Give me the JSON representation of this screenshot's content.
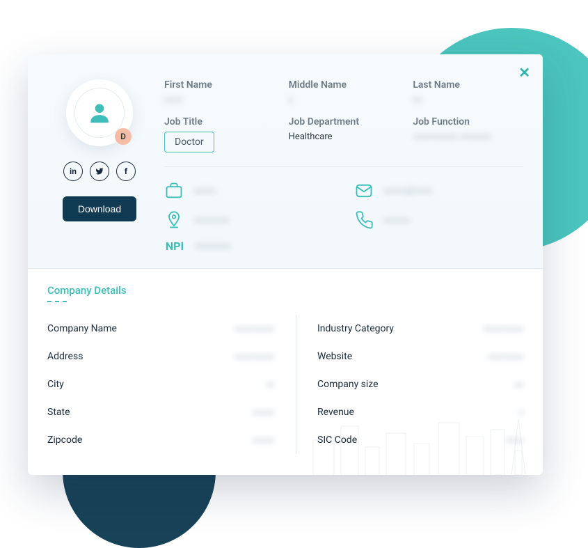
{
  "avatar_badge": "D",
  "download_label": "Download",
  "names": {
    "first": {
      "label": "First Name",
      "value": ""
    },
    "middle": {
      "label": "Middle Name",
      "value": ""
    },
    "last": {
      "label": "Last Name",
      "value": ""
    }
  },
  "job": {
    "title": {
      "label": "Job Title",
      "value": "Doctor"
    },
    "department": {
      "label": "Job Department",
      "value": "Healthcare"
    },
    "function": {
      "label": "Job Function",
      "value": ""
    }
  },
  "contacts": {
    "work": "",
    "email": "",
    "location": "",
    "phone": "",
    "npi_label": "NPI",
    "npi_value": ""
  },
  "company_section_title": "Company Details",
  "company_left": [
    {
      "label": "Company Name",
      "value": ""
    },
    {
      "label": "Address",
      "value": ""
    },
    {
      "label": "City",
      "value": ""
    },
    {
      "label": "State",
      "value": ""
    },
    {
      "label": "Zipcode",
      "value": ""
    }
  ],
  "company_right": [
    {
      "label": "Industry Category",
      "value": ""
    },
    {
      "label": "Website",
      "value": ""
    },
    {
      "label": "Company size",
      "value": ""
    },
    {
      "label": "Revenue",
      "value": ""
    },
    {
      "label": "SIC Code",
      "value": ""
    }
  ]
}
